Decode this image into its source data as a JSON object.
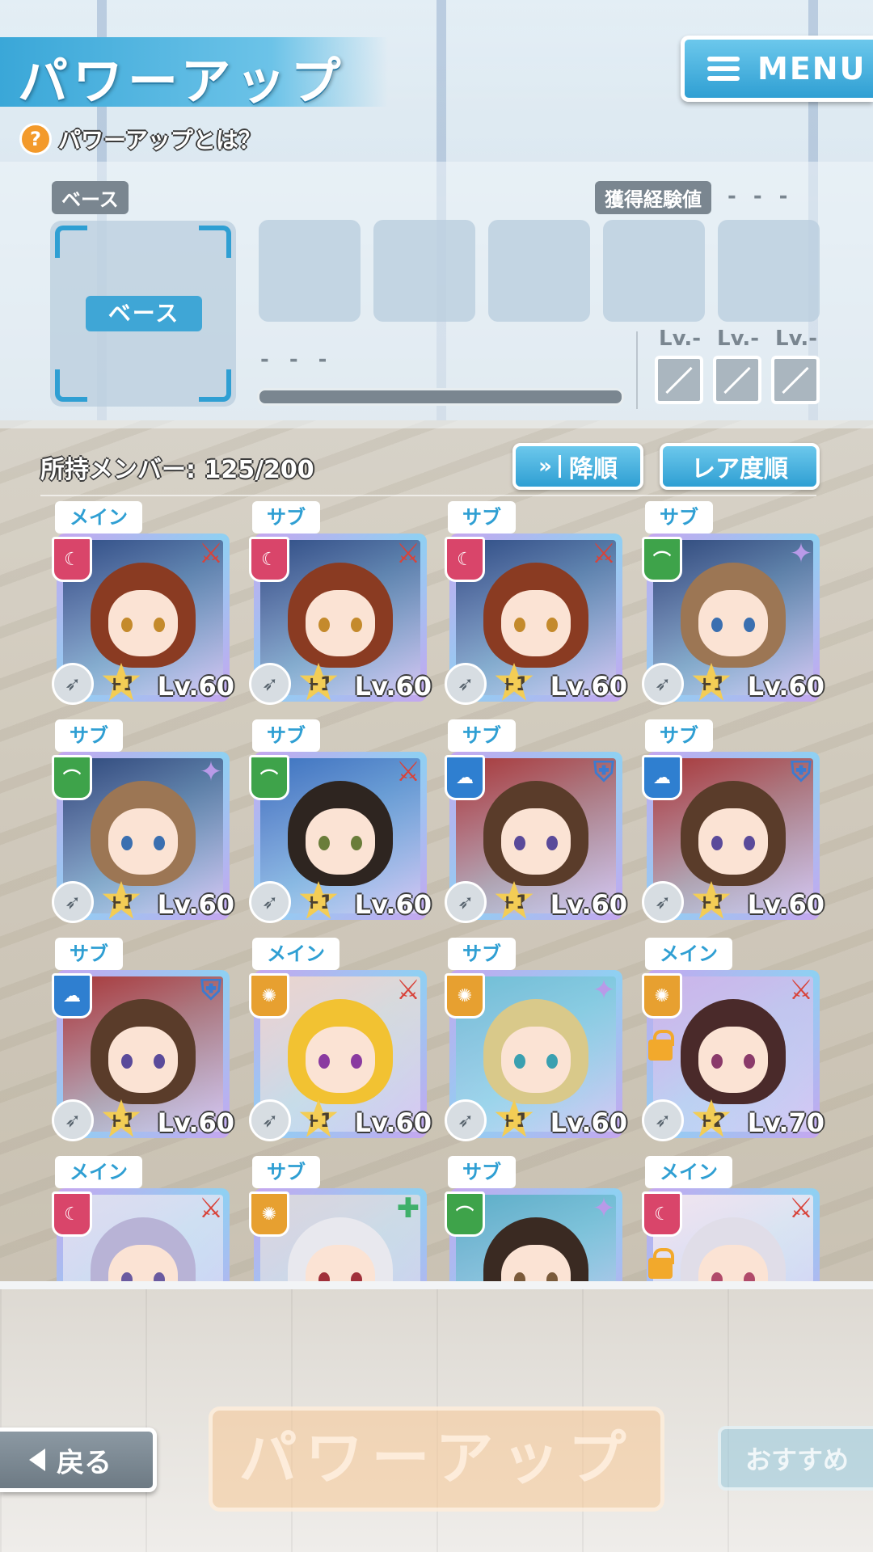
{
  "header": {
    "title": "パワーアップ",
    "menu_label": "MENU",
    "help_text": "パワーアップとは？"
  },
  "base_panel": {
    "base_tag": "ベース",
    "base_button": "ベース",
    "exp_label": "獲得経験値",
    "exp_value": "- - -",
    "material_name": "- - -",
    "skill_levels": [
      "Lv.-",
      "Lv.-",
      "Lv.-"
    ]
  },
  "member_list": {
    "count_label": "所持メンバー: 125/200",
    "sort_order_button": "降順",
    "sort_key_button": "レア度順",
    "cards": [
      {
        "tag": "メイン",
        "attr": "moon",
        "role": "sword",
        "plus": "+1",
        "level": "Lv.60",
        "hair": "#8a3b22",
        "eye": "#c48a2c",
        "bg": "#2e4f86"
      },
      {
        "tag": "サブ",
        "attr": "moon",
        "role": "sword",
        "plus": "+1",
        "level": "Lv.60",
        "hair": "#8a3b22",
        "eye": "#c48a2c",
        "bg": "#2e4f86"
      },
      {
        "tag": "サブ",
        "attr": "moon",
        "role": "sword",
        "plus": "+1",
        "level": "Lv.60",
        "hair": "#8a3b22",
        "eye": "#c48a2c",
        "bg": "#2e4f86"
      },
      {
        "tag": "サブ",
        "attr": "leaf",
        "role": "star",
        "plus": "+1",
        "level": "Lv.60",
        "hair": "#9c7654",
        "eye": "#3a6fb0",
        "bg": "#2c4a7c"
      },
      {
        "tag": "サブ",
        "attr": "leaf",
        "role": "star",
        "plus": "+1",
        "level": "Lv.60",
        "hair": "#9c7654",
        "eye": "#3a6fb0",
        "bg": "#2c4a7c"
      },
      {
        "tag": "サブ",
        "attr": "leaf",
        "role": "sword",
        "plus": "+1",
        "level": "Lv.60",
        "hair": "#2e2520",
        "eye": "#6a7d3a",
        "bg": "#3b74c0"
      },
      {
        "tag": "サブ",
        "attr": "cloud",
        "role": "shield",
        "plus": "+1",
        "level": "Lv.60",
        "hair": "#5a3c2a",
        "eye": "#5a4a9a",
        "bg": "#a63a3a"
      },
      {
        "tag": "サブ",
        "attr": "cloud",
        "role": "shield",
        "plus": "+1",
        "level": "Lv.60",
        "hair": "#5a3c2a",
        "eye": "#5a4a9a",
        "bg": "#a63a3a"
      },
      {
        "tag": "サブ",
        "attr": "cloud",
        "role": "shield",
        "plus": "+1",
        "level": "Lv.60",
        "hair": "#5a3c2a",
        "eye": "#5a4a9a",
        "bg": "#a63a3a"
      },
      {
        "tag": "メイン",
        "attr": "sun",
        "role": "sword",
        "plus": "+1",
        "level": "Lv.60",
        "hair": "#f2c232",
        "eye": "#8a3aa0",
        "bg": "#e9d6cf"
      },
      {
        "tag": "サブ",
        "attr": "sun",
        "role": "star",
        "plus": "+1",
        "level": "Lv.60",
        "hair": "#d9c98a",
        "eye": "#3aa0b0",
        "bg": "#6ec0d6"
      },
      {
        "tag": "メイン",
        "attr": "sun",
        "role": "sword",
        "plus": "+2",
        "level": "Lv.70",
        "hair": "#4a2a2a",
        "eye": "#8a3a6a",
        "bg": "#c9b6ea",
        "locked": true
      },
      {
        "tag": "メイン",
        "attr": "moon",
        "role": "sword",
        "plus": "",
        "level": "",
        "hair": "#b8b3d6",
        "eye": "#6a5aa0",
        "bg": "#dcdff0"
      },
      {
        "tag": "サブ",
        "attr": "sun",
        "role": "medic",
        "plus": "",
        "level": "",
        "hair": "#e8e8ee",
        "eye": "#a0303a",
        "bg": "#d8d8de"
      },
      {
        "tag": "サブ",
        "attr": "leaf",
        "role": "star",
        "plus": "",
        "level": "",
        "hair": "#3a2a22",
        "eye": "#7a5a3a",
        "bg": "#5ab0c8"
      },
      {
        "tag": "メイン",
        "attr": "moon",
        "role": "sword",
        "plus": "",
        "level": "",
        "hair": "#e0dde8",
        "eye": "#b04a6a",
        "bg": "#efe6f0",
        "locked": true
      }
    ]
  },
  "footer": {
    "back_label": "戻る",
    "powerup_label": "パワーアップ",
    "recommend_label": "おすすめ"
  },
  "colors": {
    "accent": "#2f9fd3",
    "moon_attr": "#d9456a",
    "leaf_attr": "#3ea34a",
    "cloud_attr": "#2f7fd0",
    "sun_attr": "#e7a030"
  }
}
